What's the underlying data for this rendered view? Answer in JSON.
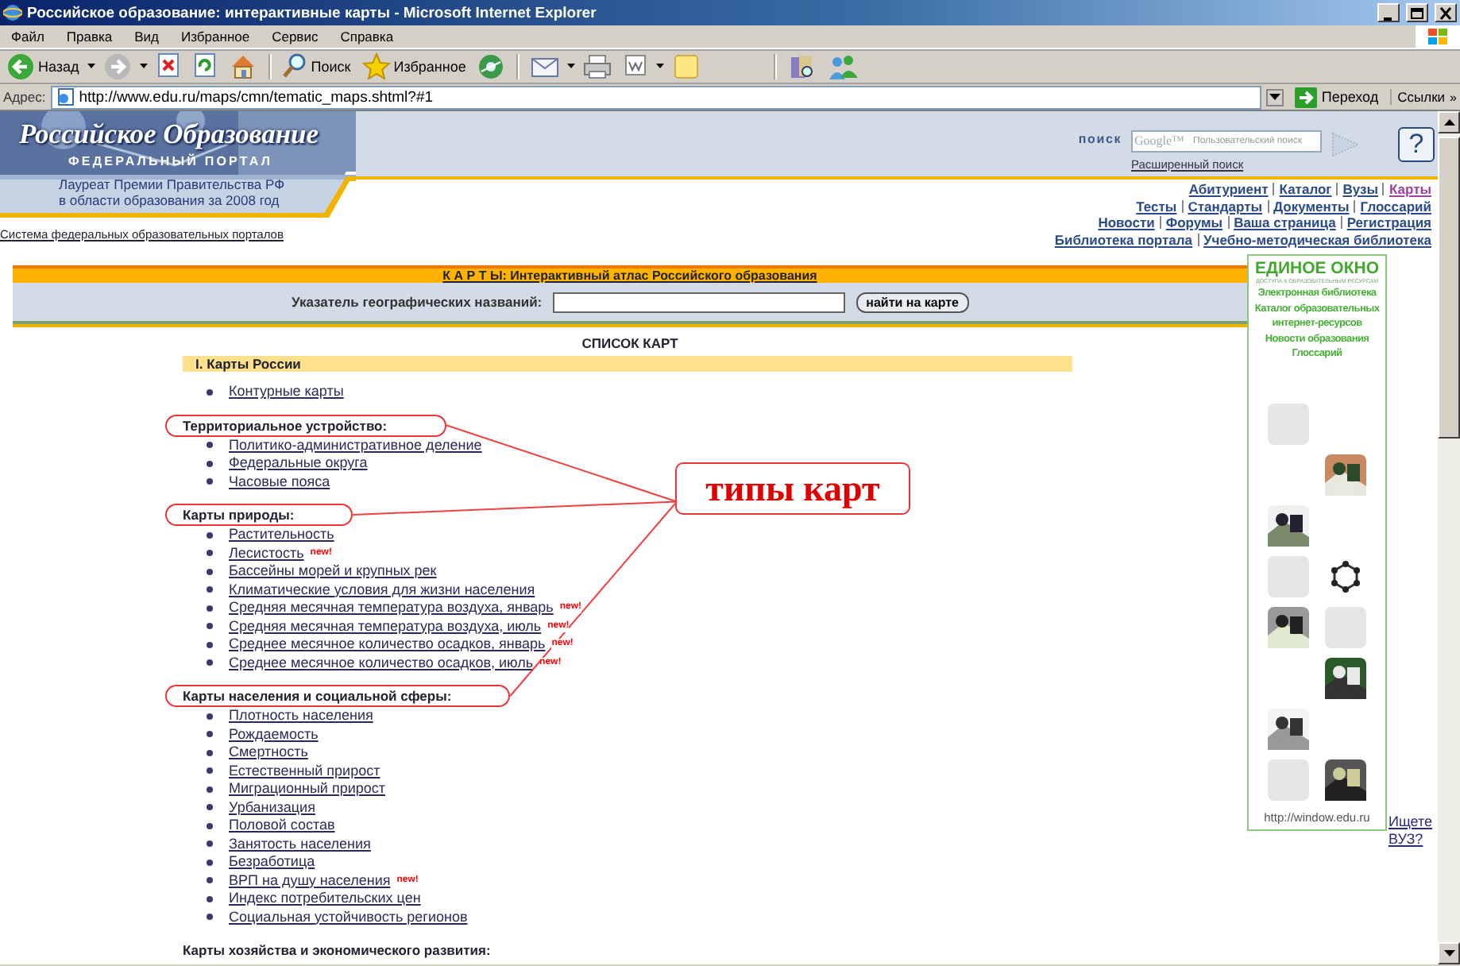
{
  "window": {
    "title": "Российское образование: интерактивные карты - Microsoft Internet Explorer"
  },
  "menu": [
    "Файл",
    "Правка",
    "Вид",
    "Избранное",
    "Сервис",
    "Справка"
  ],
  "toolbar": [
    {
      "kind": "back",
      "label": "Назад"
    },
    {
      "kind": "forward"
    },
    {
      "kind": "stop"
    },
    {
      "kind": "refresh"
    },
    {
      "kind": "home"
    },
    {
      "kind": "search",
      "label": "Поиск"
    },
    {
      "kind": "favorites",
      "label": "Избранное"
    },
    {
      "kind": "media"
    },
    {
      "kind": "mail"
    },
    {
      "kind": "print"
    },
    {
      "kind": "edit"
    },
    {
      "kind": "note"
    },
    {
      "kind": "research"
    },
    {
      "kind": "messenger"
    }
  ],
  "address": {
    "label": "Адрес:",
    "value": "http://www.edu.ru/maps/cmn/tematic_maps.shtml?#1",
    "go": "Переход",
    "links": "Ссылки",
    "more": "»"
  },
  "header": {
    "logo_title": "Российское Образование",
    "logo_subtitle": "ФЕДЕРАЛЬНЫЙ ПОРТАЛ",
    "award": [
      "Лауреат Премии Правительства РФ",
      "в области образования за 2008 год"
    ],
    "search_label": "поиск",
    "search_logo": "Google™",
    "search_placeholder": "Пользовательский поиск",
    "advanced": "Расширенный поиск",
    "help": "?"
  },
  "portal_link": "Система федеральных образовательных порталов",
  "nav_rows": [
    [
      {
        "label": "Абитуриент",
        "selected": false
      },
      {
        "label": "Каталог",
        "selected": false
      },
      {
        "label": "Вузы",
        "selected": false
      },
      {
        "label": "Карты",
        "selected": true
      }
    ],
    [
      {
        "label": "Тесты",
        "selected": false
      },
      {
        "label": "Стандарты",
        "selected": false
      },
      {
        "label": "Документы",
        "selected": false
      },
      {
        "label": "Глоссарий",
        "selected": false
      }
    ],
    [
      {
        "label": "Новости",
        "selected": false
      },
      {
        "label": "Форумы",
        "selected": false
      },
      {
        "label": "Ваша страница",
        "selected": false
      },
      {
        "label": "Регистрация",
        "selected": false
      }
    ],
    [
      {
        "label": "Библиотека портала",
        "selected": false
      },
      {
        "label": "Учебно-методическая библиотека",
        "selected": false
      }
    ]
  ],
  "atlas": {
    "title": "К А Р Т Ы: Интерактивный атлас Российского образования",
    "gazetteer_label": "Указатель географических названий:",
    "button": "найти на карте"
  },
  "list_title": "СПИСОК КАРТ",
  "section": "I. Карты России",
  "groups": [
    {
      "items": [
        {
          "label": "Контурные карты"
        }
      ]
    },
    {
      "heading": "Территориальное устройство:",
      "highlighted": true,
      "items": [
        {
          "label": "Политико-административное деление"
        },
        {
          "label": "Федеральные округа"
        },
        {
          "label": "Часовые пояса"
        }
      ]
    },
    {
      "heading": "Карты природы:",
      "highlighted": true,
      "items": [
        {
          "label": "Растительность"
        },
        {
          "label": "Лесистость",
          "badge": "new!"
        },
        {
          "label": "Бассейны морей и крупных рек"
        },
        {
          "label": "Климатические условия для жизни населения"
        },
        {
          "label": "Средняя месячная температура воздуха, январь",
          "badge": "new!"
        },
        {
          "label": "Средняя месячная температура воздуха, июль",
          "badge": "new!"
        },
        {
          "label": "Среднее месячное количество осадков, январь",
          "badge": "new!"
        },
        {
          "label": "Среднее месячное количество осадков, июль",
          "badge": "new!"
        }
      ]
    },
    {
      "heading": "Карты населения и социальной сферы:",
      "highlighted": true,
      "items": [
        {
          "label": "Плотность населения"
        },
        {
          "label": "Рождаемость"
        },
        {
          "label": "Смертность"
        },
        {
          "label": "Естественный прирост"
        },
        {
          "label": "Миграционный прирост"
        },
        {
          "label": "Урбанизация"
        },
        {
          "label": "Половой состав"
        },
        {
          "label": "Занятость населения"
        },
        {
          "label": "Безработица"
        },
        {
          "label": "ВРП на душу населения",
          "badge": "new!"
        },
        {
          "label": "Индекс потребительских цен"
        },
        {
          "label": "Социальная устойчивость регионов"
        }
      ]
    },
    {
      "heading": "Карты хозяйства и экономического развития:",
      "highlighted": false
    }
  ],
  "annotation": {
    "label": "типы карт"
  },
  "sidebar": {
    "banner": {
      "title": "ЕДИНОЕ ОКНО",
      "subtitle": "ДОСТУПА К ОБРАЗОВАТЕЛЬНЫМ РЕСУРСАМ",
      "links": [
        "Электронная библиотека",
        "Каталог образовательных интернет-ресурсов",
        "Новости образования",
        "Глоссарий"
      ],
      "url": "http://window.edu.ru"
    },
    "link": "Ищете ВУЗ?"
  }
}
